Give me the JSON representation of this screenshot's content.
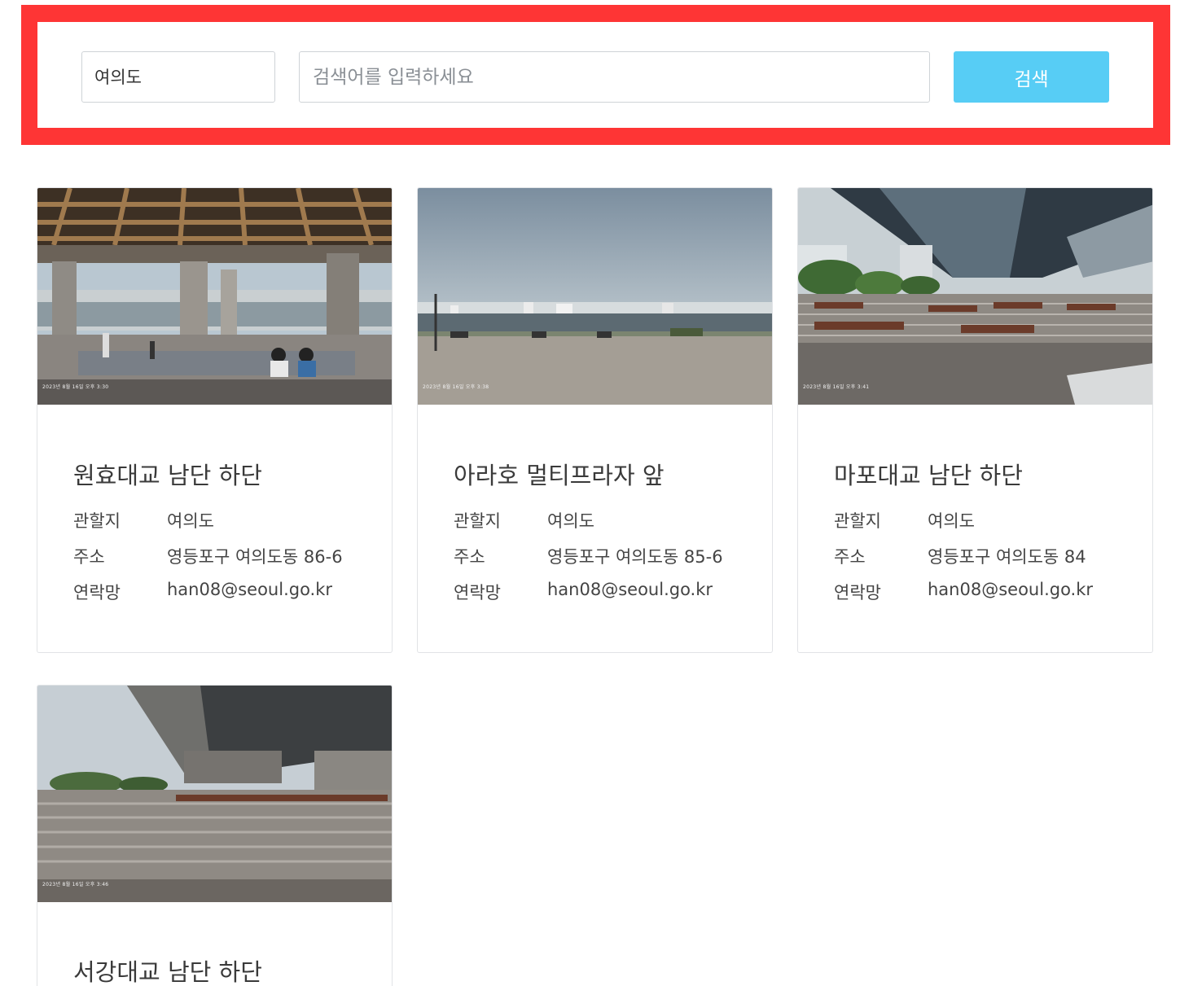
{
  "search": {
    "region": "여의도",
    "keyword_value": "",
    "keyword_placeholder": "검색어를 입력하세요",
    "button_label": "검색"
  },
  "cards": [
    {
      "title": "원효대교 남단 하단",
      "photo_stamp": "2023년 8월 16일 오후 3:30",
      "rows": [
        {
          "label": "관할지",
          "value": "여의도"
        },
        {
          "label": "주소",
          "value": "영등포구 여의도동 86-6"
        },
        {
          "label": "연락망",
          "value": "han08@seoul.go.kr"
        }
      ]
    },
    {
      "title": "아라호 멀티프라자 앞",
      "photo_stamp": "2023년 8월 16일 오후 3:38",
      "rows": [
        {
          "label": "관할지",
          "value": "여의도"
        },
        {
          "label": "주소",
          "value": "영등포구 여의도동 85-6"
        },
        {
          "label": "연락망",
          "value": "han08@seoul.go.kr"
        }
      ]
    },
    {
      "title": "마포대교 남단 하단",
      "photo_stamp": "2023년 8월 16일 오후 3:41",
      "rows": [
        {
          "label": "관할지",
          "value": "여의도"
        },
        {
          "label": "주소",
          "value": "영등포구 여의도동 84"
        },
        {
          "label": "연락망",
          "value": "han08@seoul.go.kr"
        }
      ]
    },
    {
      "title": "서강대교 남단 하단",
      "photo_stamp": "2023년 8월 16일 오후 3:46",
      "rows": []
    }
  ],
  "colors": {
    "highlight_border": "#fe3535",
    "search_button": "#57cdf5",
    "card_border": "#e1e3e6"
  }
}
